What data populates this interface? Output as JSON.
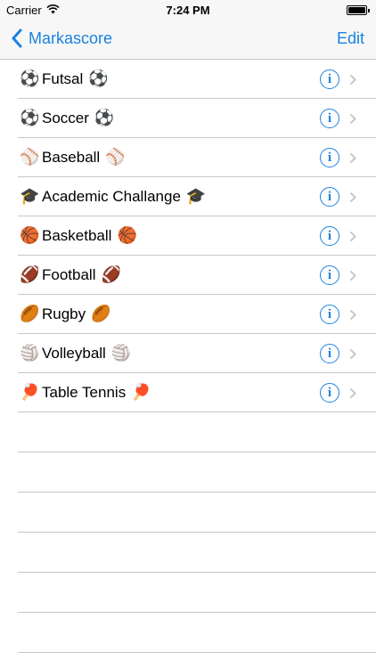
{
  "status_bar": {
    "carrier": "Carrier",
    "time": "7:24 PM"
  },
  "nav": {
    "back_label": "Markascore",
    "edit_label": "Edit"
  },
  "sports": [
    {
      "name": "Futsal",
      "emoji": "⚽",
      "icon": "soccer-ball-icon"
    },
    {
      "name": "Soccer",
      "emoji": "⚽",
      "icon": "soccer-ball-icon"
    },
    {
      "name": "Baseball",
      "emoji": "⚾",
      "icon": "baseball-icon"
    },
    {
      "name": "Academic Challange",
      "emoji": "🎓",
      "icon": "graduation-cap-icon"
    },
    {
      "name": "Basketball",
      "emoji": "🏀",
      "icon": "basketball-icon"
    },
    {
      "name": "Football",
      "emoji": "🏈",
      "icon": "football-icon"
    },
    {
      "name": "Rugby",
      "emoji": "🏉",
      "icon": "rugby-ball-icon"
    },
    {
      "name": "Volleyball",
      "emoji": "🏐",
      "icon": "volleyball-icon"
    },
    {
      "name": "Table Tennis",
      "emoji": "🏓",
      "icon": "ping-pong-icon"
    }
  ],
  "colors": {
    "tint": "#1a82e0",
    "separator": "#c8c7cc",
    "bar_background": "#f7f7f7",
    "chevron": "#c7c7cc"
  }
}
